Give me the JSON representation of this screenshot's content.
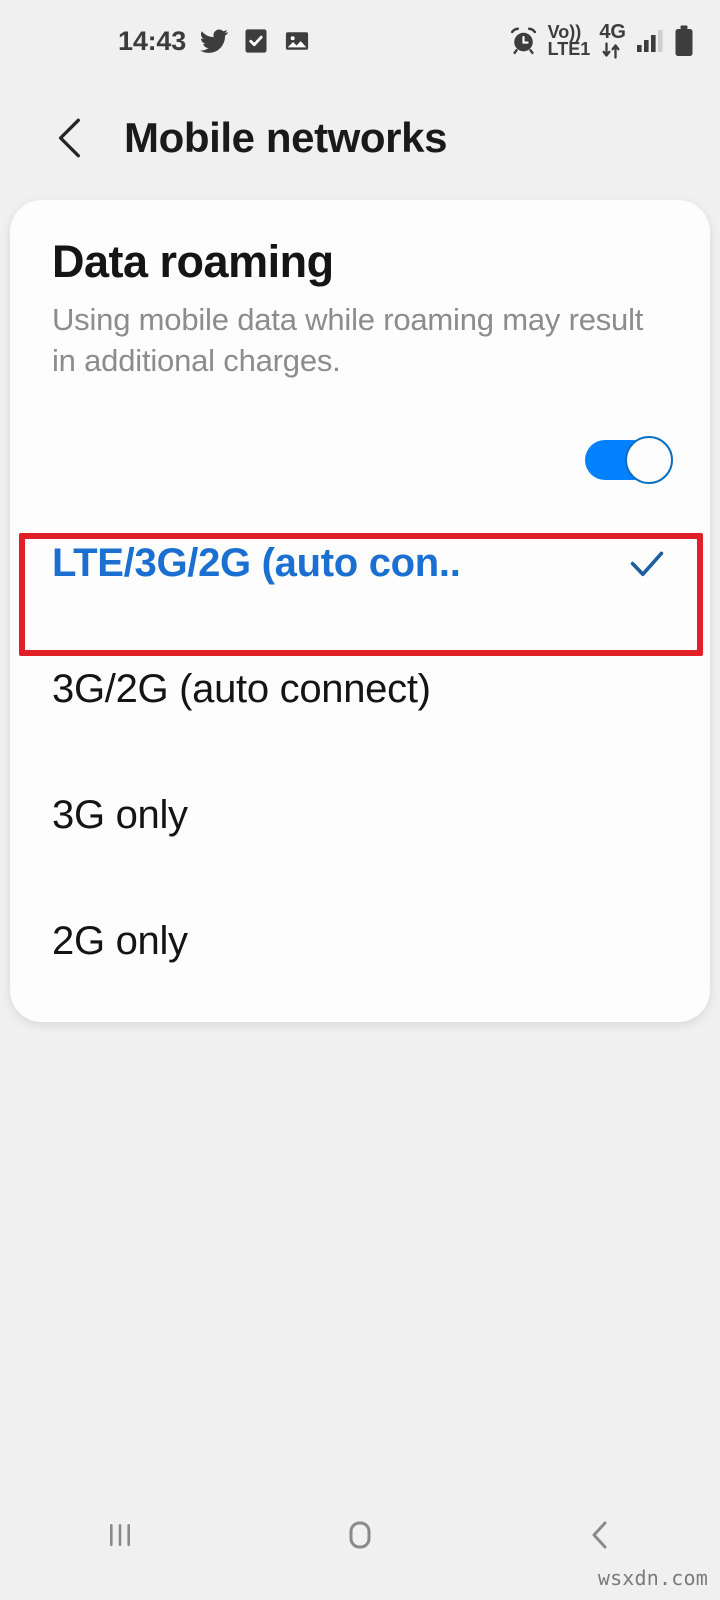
{
  "status_bar": {
    "time": "14:43",
    "left_icons": [
      "twitter-icon",
      "tasks-checkbox-icon",
      "gallery-image-icon"
    ],
    "right_icons": [
      "alarm-clock-icon",
      "volte-icon",
      "4g-data-icon",
      "signal-bars-icon",
      "battery-icon"
    ],
    "volte_top_label": "Vo))",
    "volte_bottom_label": "LTE1",
    "network_type_label": "4G",
    "signal_bars": 3,
    "battery_level_percent": 90
  },
  "header": {
    "back_icon": "chevron-left-icon",
    "title": "Mobile networks"
  },
  "roaming": {
    "title": "Data roaming",
    "description": "Using mobile data while roaming may result in additional charges.",
    "toggle_state": "on",
    "toggle_accent_color": "#0381fe"
  },
  "network_mode": {
    "selected_index": 0,
    "selected_color": "#1a6fd0",
    "check_icon": "check-icon",
    "options": [
      {
        "label": "LTE/3G/2G (auto con..",
        "selected": true
      },
      {
        "label": "3G/2G (auto connect)",
        "selected": false
      },
      {
        "label": "3G only",
        "selected": false
      },
      {
        "label": "2G only",
        "selected": false
      }
    ]
  },
  "annotation": {
    "type": "highlight-rectangle",
    "color": "#e11f26",
    "target": "LTE/3G/2G (auto con.."
  },
  "nav_bar": {
    "recents_icon": "recents-icon",
    "home_icon": "home-icon",
    "back_icon": "nav-back-chevron-icon"
  },
  "watermark": {
    "text": "wsxdn.com"
  }
}
